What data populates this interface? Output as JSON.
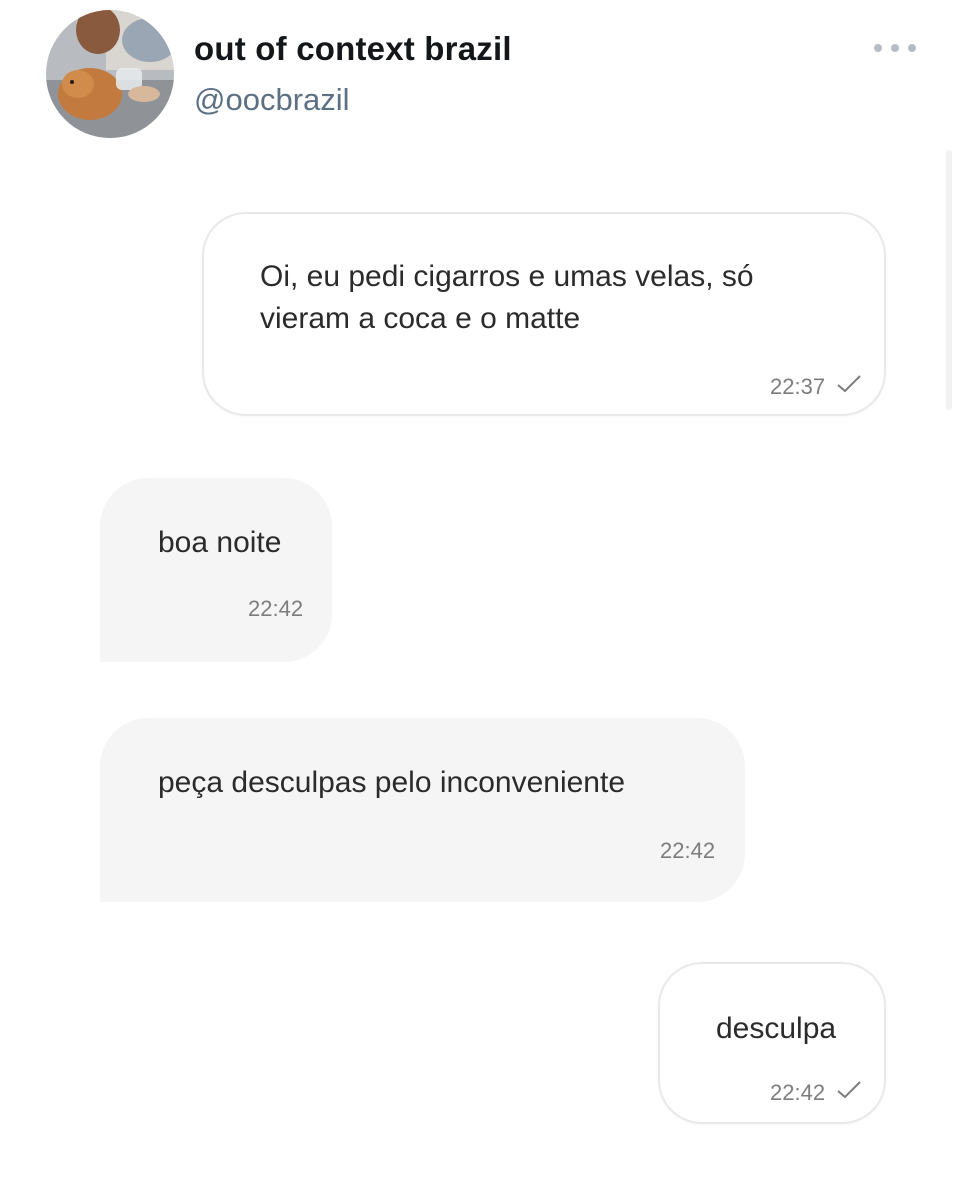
{
  "header": {
    "display_name": "out of context brazil",
    "handle": "@oocbrazil",
    "avatar_icon": "avatar-photo-dog",
    "more_icon": "more-horizontal-icon"
  },
  "messages": [
    {
      "direction": "outgoing",
      "text_lines": [
        "Oi, eu pedi cigarros e umas velas, só",
        "vieram a coca e o matte"
      ],
      "time": "22:37",
      "status_icon": "check-icon"
    },
    {
      "direction": "incoming",
      "text": "boa noite",
      "time": "22:42"
    },
    {
      "direction": "incoming",
      "text": "peça desculpas pelo inconveniente",
      "time": "22:42"
    },
    {
      "direction": "outgoing",
      "text": "desculpa",
      "time": "22:42",
      "status_icon": "check-icon"
    }
  ],
  "colors": {
    "outgoing_bubble": "#ffffff",
    "outgoing_border": "#e9e9e9",
    "incoming_bubble": "#f5f5f5",
    "time_text": "#7d7d7d",
    "handle_text": "#5b7083"
  }
}
